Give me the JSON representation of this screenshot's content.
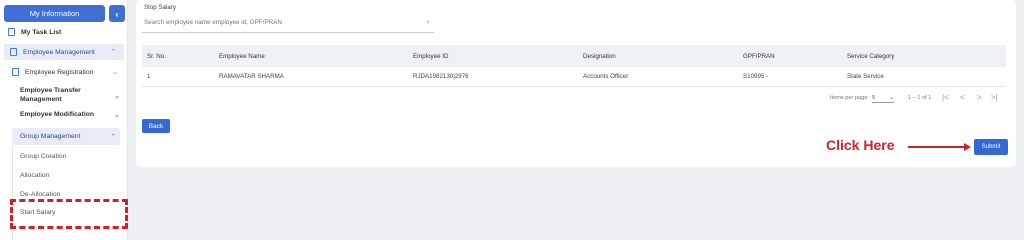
{
  "sidebar": {
    "header_label": "My Information",
    "collapse_glyph": "‹",
    "task_list": "My Task List",
    "employee_management": "Employee Management",
    "employee_registration": "Employee Registration",
    "employee_transfer": "Employee Transfer Management",
    "employee_modification": "Employee Modification",
    "group_management": "Group Management",
    "sub_items": [
      "Group Creation",
      "Allocation",
      "De-Allocation",
      "Start Salary"
    ],
    "chevron_down": "⌄",
    "chevron_up": "⌃"
  },
  "main": {
    "title": "Stop Salary",
    "search_placeholder": "Search employee name employee id, GPF/PRAN",
    "search_icon_glyph": "⌕",
    "columns": [
      "Sr. No.",
      "Employee Name",
      "Employee ID",
      "Designation",
      "GPF/PRAN",
      "Service Category"
    ],
    "rows": [
      [
        "1",
        "RAMAVATAR SHARMA",
        "RJDA1982130|2976",
        "Accounts Officer",
        "S10995 -",
        "State Service"
      ]
    ],
    "pagination": {
      "items_per_page_label": "Items per page:",
      "items_per_page_value": "5",
      "range": "1 – 1 of 1",
      "first": "|<",
      "prev": "<",
      "next": ">",
      "last": ">|"
    },
    "back_label": "Back",
    "submit_label": "Submit"
  },
  "annotation": {
    "click_here": "Click Here",
    "color": "#d41f2a"
  },
  "colors": {
    "accent": "#3469d4",
    "sidebar_active": "#e7ecf6"
  }
}
